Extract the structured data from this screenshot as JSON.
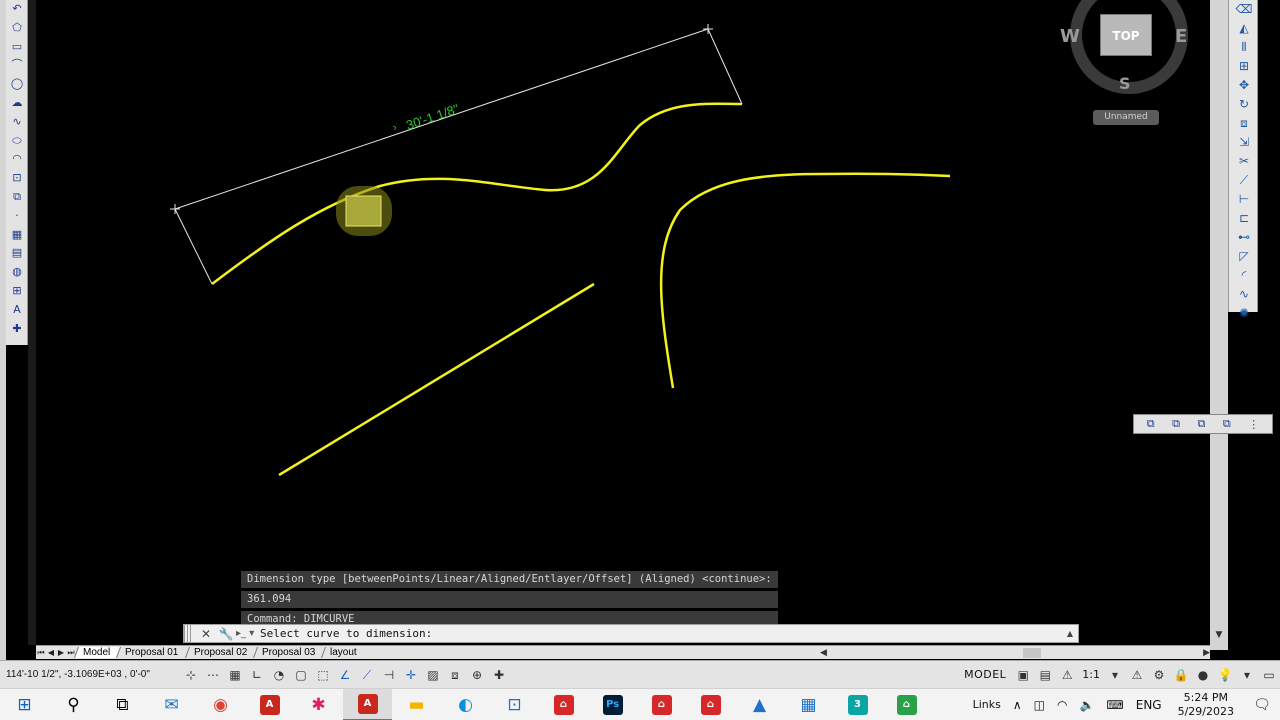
{
  "drawing": {
    "dimension_text": "30'-1 1/8\""
  },
  "viewcube": {
    "top_label": "TOP",
    "west": "W",
    "east": "E",
    "south": "S",
    "wcs_label": "Unnamed"
  },
  "command": {
    "history": [
      "Dimension type [betweenPoints/Linear/Aligned/Entlayer/Offset] (Aligned) <continue>:",
      "361.094",
      "Command: DIMCURVE"
    ],
    "prompt": "Select curve to dimension:"
  },
  "layout_tabs": {
    "tabs": [
      "Model",
      "Proposal 01",
      "Proposal 02",
      "Proposal 03",
      "layout"
    ],
    "active": "Model"
  },
  "status_bar": {
    "coordinates": "114'-10 1/2\", -3.1069E+03 , 0'-0\"",
    "space": "MODEL",
    "annotation_scale": "1:1"
  },
  "taskbar": {
    "links_label": "Links",
    "language": "ENG",
    "time": "5:24 PM",
    "date": "5/29/2023",
    "apps": [
      {
        "icon": "windows-start-icon",
        "color": "#0a64c8"
      },
      {
        "icon": "search-icon",
        "color": "#222222"
      },
      {
        "icon": "task-view-icon",
        "color": "#222222"
      },
      {
        "icon": "mail-icon",
        "color": "#1e70c8"
      },
      {
        "icon": "chrome-icon",
        "color": "#db4437"
      },
      {
        "icon": "acrobat-icon",
        "color": "#c8281e"
      },
      {
        "icon": "slack-icon",
        "color": "#4a154b"
      },
      {
        "icon": "autocad-icon",
        "color": "#c8281e"
      },
      {
        "icon": "file-explorer-icon",
        "color": "#f5b400"
      },
      {
        "icon": "edge-icon",
        "color": "#0f8fd8"
      },
      {
        "icon": "store-icon",
        "color": "#1e70c8"
      },
      {
        "icon": "app-red-icon",
        "color": "#d62828"
      },
      {
        "icon": "photoshop-icon",
        "color": "#001e36"
      },
      {
        "icon": "app-red-2-icon",
        "color": "#d62828"
      },
      {
        "icon": "app-red-3-icon",
        "color": "#d62828"
      },
      {
        "icon": "photos-icon",
        "color": "#1e70c8"
      },
      {
        "icon": "calculator-icon",
        "color": "#1e70c8"
      },
      {
        "icon": "3dsmax-icon",
        "color": "#0aa5a5"
      },
      {
        "icon": "sketch-icon",
        "color": "#2aa148"
      }
    ],
    "app_labels": {
      "photoshop": "Ps",
      "max": "3"
    }
  },
  "colors": {
    "curve": "#f2f21a",
    "dimension_line": "#e6e6e6",
    "dimension_text": "#2ec62e"
  }
}
